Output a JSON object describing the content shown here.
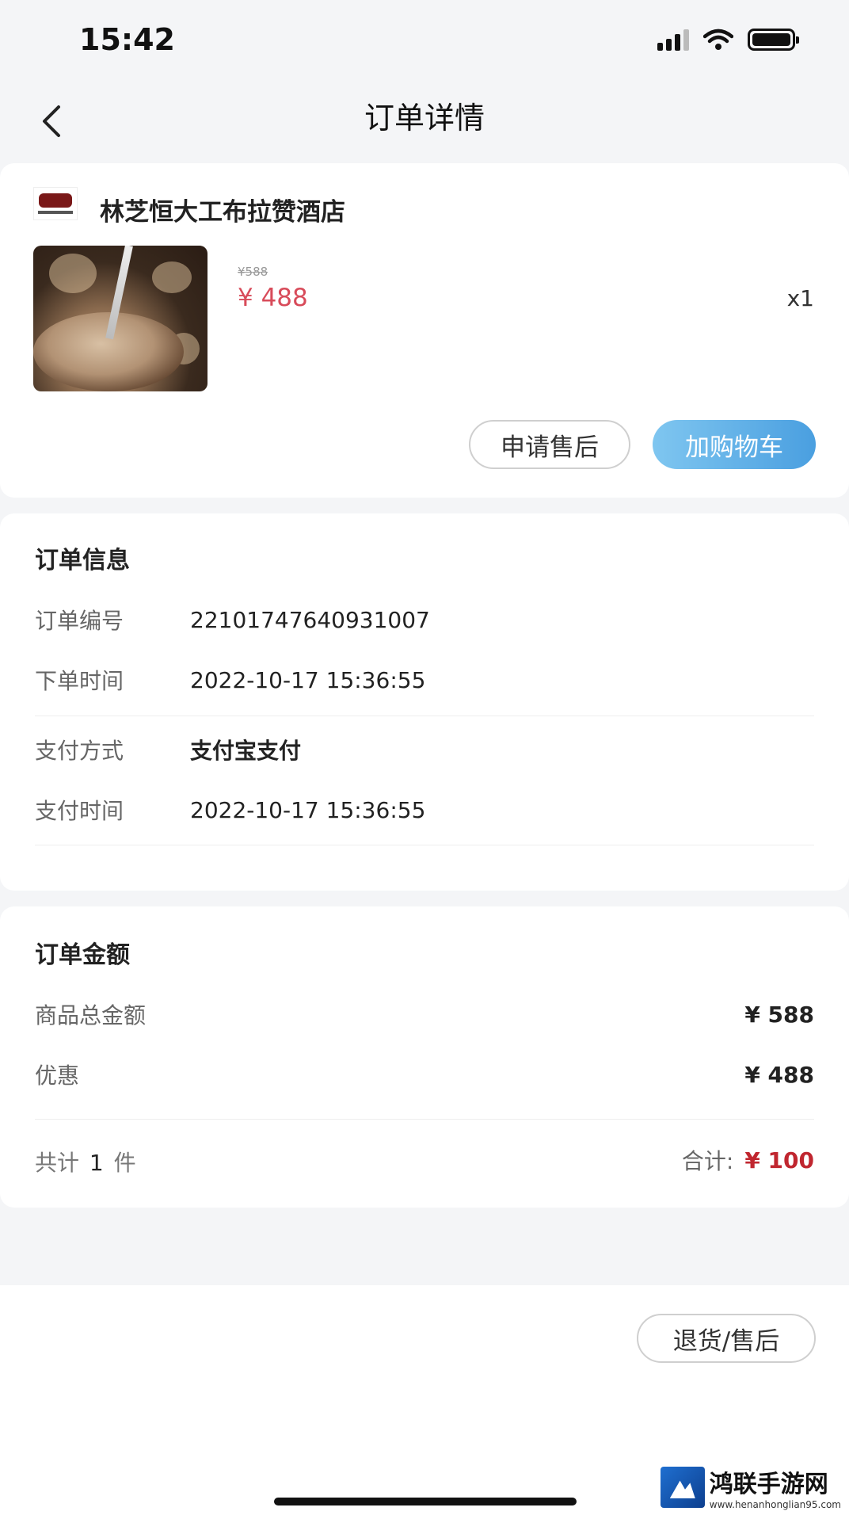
{
  "status_bar": {
    "time": "15:42"
  },
  "nav": {
    "title": "订单详情"
  },
  "store": {
    "name": "林芝恒大工布拉赞酒店",
    "product": {
      "original_price": "¥588",
      "price": "¥ 488",
      "quantity": "x1"
    },
    "buttons": {
      "after_sale": "申请售后",
      "add_to_cart": "加购物车"
    }
  },
  "order_info": {
    "title": "订单信息",
    "rows": [
      {
        "label": "订单编号",
        "value": "22101747640931007"
      },
      {
        "label": "下单时间",
        "value": "2022-10-17 15:36:55"
      },
      {
        "label": "支付方式",
        "value": "支付宝支付"
      },
      {
        "label": "支付时间",
        "value": "2022-10-17 15:36:55"
      }
    ]
  },
  "order_amount": {
    "title": "订单金额",
    "rows": [
      {
        "label": "商品总金额",
        "value": "¥ 588"
      },
      {
        "label": "优惠",
        "value": "¥ 488"
      }
    ],
    "count_prefix": "共计",
    "count": "1",
    "count_suffix": "件",
    "total_label": "合计:",
    "total_value": "¥ 100"
  },
  "bottom": {
    "return_button": "退货/售后"
  },
  "watermark": {
    "name": "鸿联手游网",
    "url": "www.henanhonglian95.com"
  },
  "colors": {
    "price_red": "#d84b5a",
    "total_red": "#c0262f",
    "cart_blue": "#4a9fe0"
  }
}
